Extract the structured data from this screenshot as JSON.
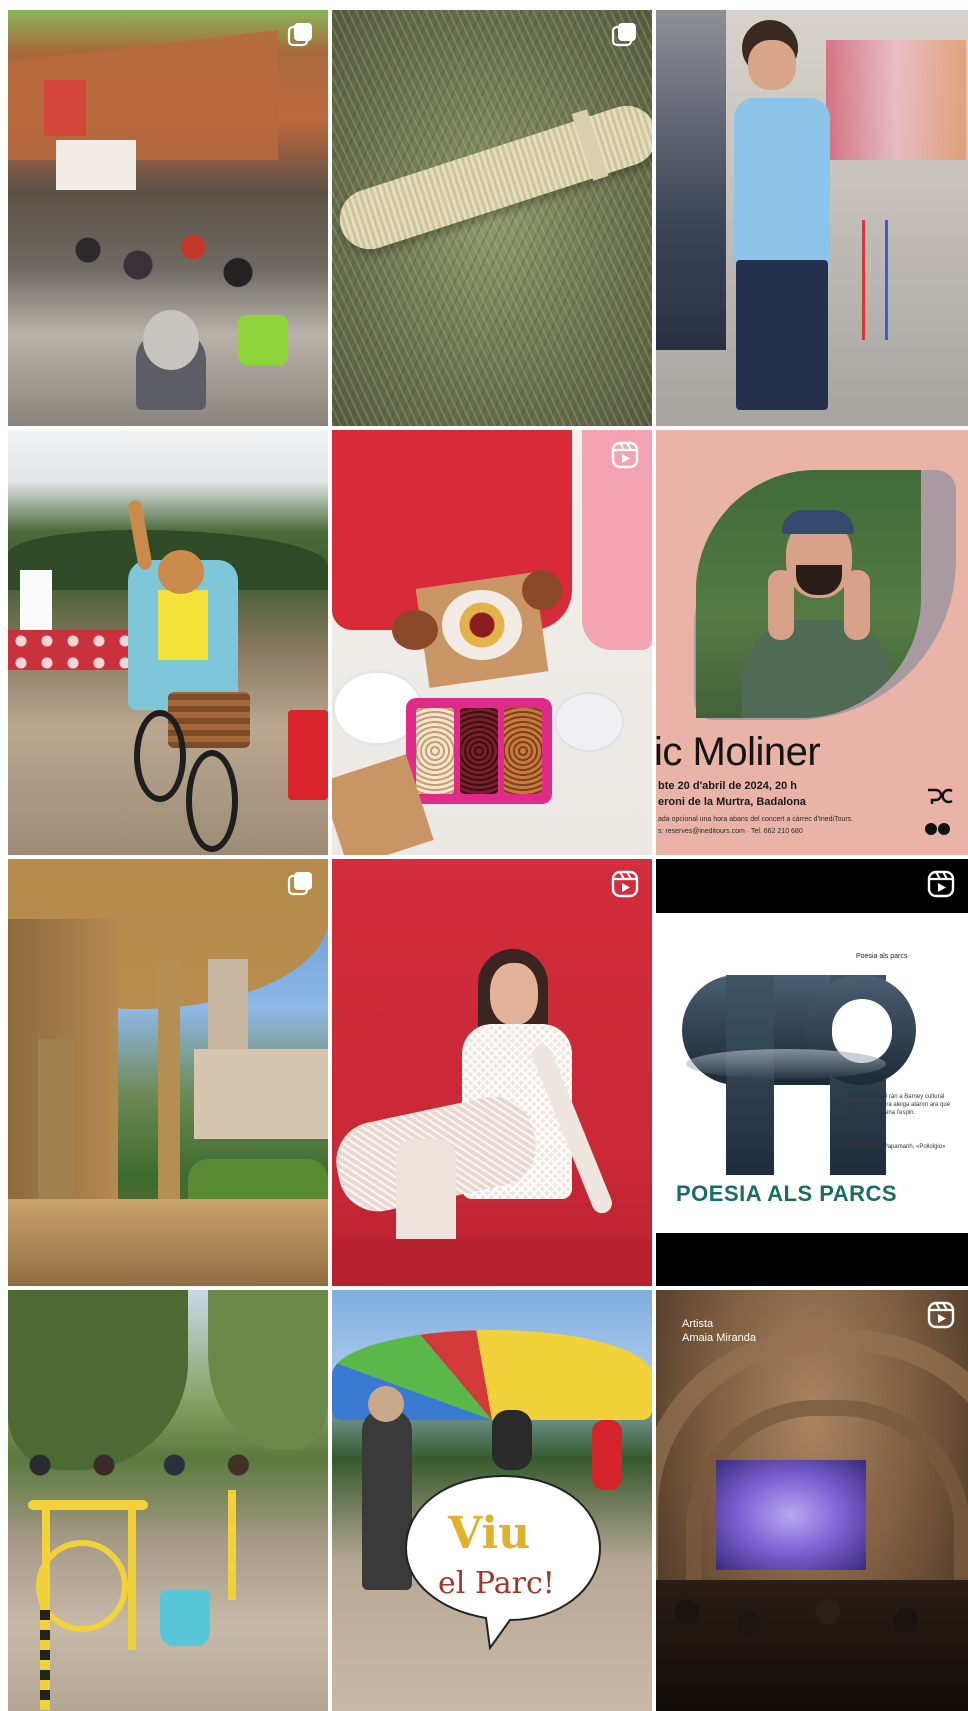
{
  "grid": {
    "posts": [
      {
        "id": "post-1",
        "type": "carousel"
      },
      {
        "id": "post-2",
        "type": "carousel"
      },
      {
        "id": "post-3",
        "type": "photo"
      },
      {
        "id": "post-4",
        "type": "photo"
      },
      {
        "id": "post-5",
        "type": "reel"
      },
      {
        "id": "post-6",
        "type": "photo"
      },
      {
        "id": "post-7",
        "type": "carousel"
      },
      {
        "id": "post-8",
        "type": "reel"
      },
      {
        "id": "post-9",
        "type": "reel"
      },
      {
        "id": "post-10",
        "type": "photo"
      },
      {
        "id": "post-11",
        "type": "photo"
      },
      {
        "id": "post-12",
        "type": "reel"
      }
    ]
  },
  "poster_moliner": {
    "name": "ic Moliner",
    "date_line": "bte 20 d'abril de 2024, 20 h",
    "place_line": "eroni de la Murtra, Badalona",
    "note_line": "ada opcional una hora abans del concert a càrrec d'InediTours.",
    "contact_line": "s: reserves@ineditours.com · Tel. 662 210 680"
  },
  "poster_poesia": {
    "small_label": "Poesia als parcs",
    "title": "POESIA ALS PARCS",
    "quote_text": "Para Toucasnel ran a Barney cultural lesacomu el obra aleiga ataron ara que cadoes pentrusina l'espin.",
    "quote_author": "Josep Gorodí Papamanh, «Pollolgio»"
  },
  "sticker_viu": {
    "line1": "Viu",
    "line2": "el Parc!"
  },
  "concert_caption": {
    "label": "Artista",
    "artist": "Amaia Miranda"
  },
  "colors": {
    "poster_pink": "#eab3a8",
    "poesia_teal": "#1c6b66",
    "viu_gold": "#e0b12a",
    "viu_red": "#9a3a2a"
  },
  "icons": {
    "carousel": "carousel-icon",
    "reel": "reel-icon"
  }
}
